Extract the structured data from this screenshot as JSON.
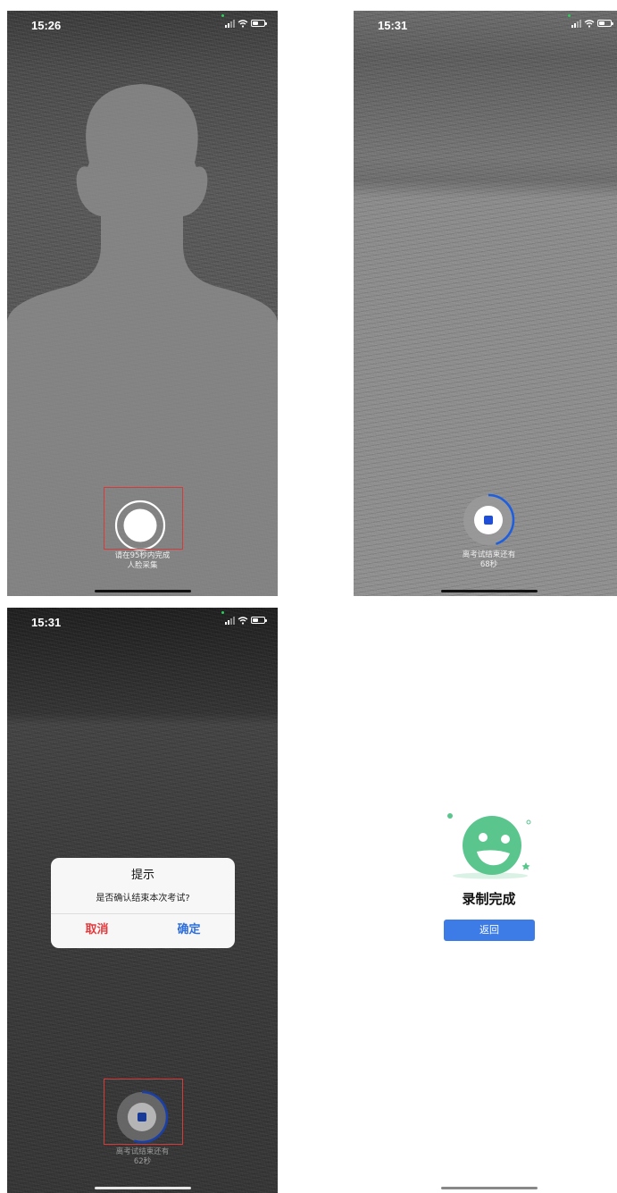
{
  "screen1": {
    "status_time": "15:26",
    "caption_line1": "请在95秒内完成",
    "caption_line2": "人脸采集"
  },
  "screen2": {
    "status_time": "15:31",
    "caption_line1": "离考试结束还有",
    "caption_line2": "68秒",
    "progress": 0.45
  },
  "screen3": {
    "status_time": "15:31",
    "caption_line1": "离考试结束还有",
    "caption_line2": "62秒",
    "progress": 0.55,
    "dialog": {
      "title": "提示",
      "message": "是否确认结束本次考试?",
      "cancel_label": "取消",
      "confirm_label": "确定"
    }
  },
  "screen4": {
    "title": "录制完成",
    "back_label": "返回"
  },
  "colors": {
    "accent_blue": "#3d7be6",
    "cancel_red": "#e4393c",
    "illustration_green": "#5bc58e",
    "highlight_box": "#d83a3a"
  }
}
